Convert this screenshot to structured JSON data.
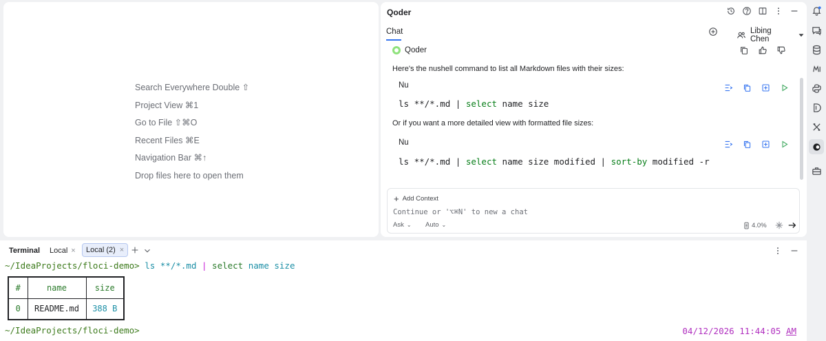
{
  "editor": {
    "hints": [
      {
        "label": "Search Everywhere",
        "shortcut": "Double ⇧"
      },
      {
        "label": "Project View",
        "shortcut": "⌘1"
      },
      {
        "label": "Go to File",
        "shortcut": "⇧⌘O"
      },
      {
        "label": "Recent Files",
        "shortcut": "⌘E"
      },
      {
        "label": "Navigation Bar",
        "shortcut": "⌘↑"
      },
      {
        "label": "Drop files here to open them",
        "shortcut": ""
      }
    ]
  },
  "qoder": {
    "title": "Qoder",
    "tab": "Chat",
    "user": "Libing Chen",
    "sender": "Qoder",
    "intro": "Here's the nushell command to list all Markdown files with their sizes:",
    "block1": {
      "lang": "Nu",
      "p1": "ls **/*.md ",
      "pipe": "|",
      "p2": " ",
      "kw1": "select",
      "p3": " name size"
    },
    "middle": "Or if you want a more detailed view with formatted file sizes:",
    "block2": {
      "lang": "Nu",
      "p1": "ls **/*.md ",
      "pipe": "|",
      "p2": " ",
      "kw1": "select",
      "p3": " name size modified ",
      "pipe2": "|",
      "p4": " ",
      "kw2": "sort-by",
      "p5": " modified -r"
    },
    "input": {
      "add_context": "Add Context",
      "placeholder": "Continue or '⌥⌘N' to new a chat",
      "mode": "Ask",
      "model": "Auto",
      "usage": "4.0%"
    }
  },
  "terminal": {
    "title": "Terminal",
    "tabs": [
      {
        "label": "Local"
      },
      {
        "label": "Local (2)"
      }
    ],
    "prompt_path": "~/IdeaProjects/floci-demo",
    "prompt_char": ">",
    "command": {
      "p1": " ls **/*.md ",
      "pipe": "|",
      "kw": " select",
      "rest": " name size"
    },
    "table": {
      "headers": [
        "#",
        "name",
        "size"
      ],
      "rows": [
        [
          "0",
          "README.md",
          "388 B"
        ]
      ]
    },
    "timestamp_date": "04/12/2026",
    "timestamp_time": "11:44:05",
    "timestamp_ampm": "AM"
  },
  "colors": {
    "accent": "#3574f0",
    "path": "#3c7a1b",
    "keyword": "#067d17",
    "pipe": "#c71bd6",
    "timestamp": "#b02fbf"
  },
  "icons": {
    "strip": [
      "notifications-icon",
      "ai-chat-icon",
      "database-icon",
      "markdown-icon",
      "python-icon",
      "dependencies-icon",
      "tools-icon",
      "qoder-icon",
      "toolbox-icon"
    ]
  }
}
